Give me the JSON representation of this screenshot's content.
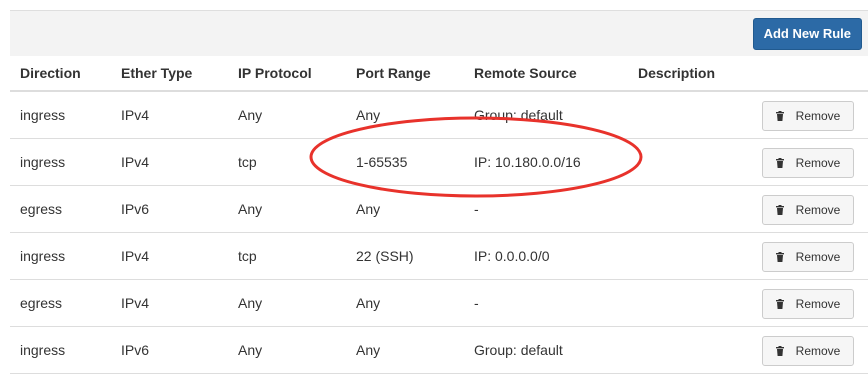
{
  "toolbar": {
    "add_rule_label": "Add New Rule"
  },
  "table": {
    "headers": [
      "Direction",
      "Ether Type",
      "IP Protocol",
      "Port Range",
      "Remote Source",
      "Description"
    ],
    "rows": [
      {
        "direction": "ingress",
        "ether_type": "IPv4",
        "ip_protocol": "Any",
        "port_range": "Any",
        "remote_source": "Group: default",
        "description": "",
        "action": "Remove"
      },
      {
        "direction": "ingress",
        "ether_type": "IPv4",
        "ip_protocol": "tcp",
        "port_range": "1-65535",
        "remote_source": "IP: 10.180.0.0/16",
        "description": "",
        "action": "Remove"
      },
      {
        "direction": "egress",
        "ether_type": "IPv6",
        "ip_protocol": "Any",
        "port_range": "Any",
        "remote_source": "-",
        "description": "",
        "action": "Remove"
      },
      {
        "direction": "ingress",
        "ether_type": "IPv4",
        "ip_protocol": "tcp",
        "port_range": "22 (SSH)",
        "remote_source": "IP: 0.0.0.0/0",
        "description": "",
        "action": "Remove"
      },
      {
        "direction": "egress",
        "ether_type": "IPv4",
        "ip_protocol": "Any",
        "port_range": "Any",
        "remote_source": "-",
        "description": "",
        "action": "Remove"
      },
      {
        "direction": "ingress",
        "ether_type": "IPv6",
        "ip_protocol": "Any",
        "port_range": "Any",
        "remote_source": "Group: default",
        "description": "",
        "action": "Remove"
      }
    ]
  },
  "icons": {
    "remove": "trash-icon"
  },
  "colors": {
    "primary_button": "#2c6aa6",
    "annotation": "#e8322b"
  }
}
